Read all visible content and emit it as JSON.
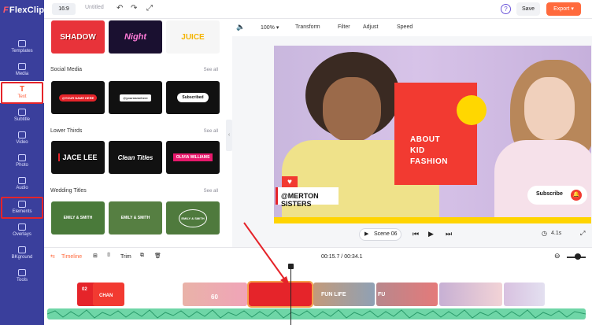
{
  "app": {
    "logo": "FlexClip"
  },
  "topbar": {
    "ratio": "16:9",
    "title": "Untitled",
    "help": "?",
    "save": "Save",
    "export": "Export ▾"
  },
  "sidebar": {
    "items": [
      {
        "label": "Templates",
        "icon": "templates-icon"
      },
      {
        "label": "Media",
        "icon": "media-icon"
      },
      {
        "label": "Text",
        "icon": "text-icon",
        "active": true
      },
      {
        "label": "Subtitle",
        "icon": "subtitle-icon"
      },
      {
        "label": "Video",
        "icon": "video-icon"
      },
      {
        "label": "Photo",
        "icon": "photo-icon"
      },
      {
        "label": "Audio",
        "icon": "audio-icon"
      },
      {
        "label": "Elements",
        "icon": "elements-icon"
      },
      {
        "label": "Overlays",
        "icon": "overlays-icon"
      },
      {
        "label": "BKground",
        "icon": "background-icon"
      },
      {
        "label": "Tools",
        "icon": "tools-icon"
      }
    ]
  },
  "panel": {
    "top_thumbs": [
      "SHADOW",
      "Night",
      "JUICE"
    ],
    "sections": [
      {
        "title": "Social Media",
        "see_all": "See all",
        "thumbs": [
          "@YOUR NAME HERE",
          "@yournamehere",
          "Subscribed"
        ]
      },
      {
        "title": "Lower Thirds",
        "see_all": "See all",
        "thumbs": [
          "JACE LEE",
          "Clean Titles",
          "OLIVIA WILLIAMS"
        ]
      },
      {
        "title": "Wedding Titles",
        "see_all": "See all",
        "thumbs": [
          "EMILY & SMITH",
          "EMILY & SMITH",
          "EMILY & SMITH"
        ]
      }
    ]
  },
  "preview_toolbar": {
    "volume": "🔈",
    "zoom": "100% ▾",
    "transform": "Transform",
    "filter": "Filter",
    "adjust": "Adjust",
    "speed": "Speed"
  },
  "video": {
    "card_lines": [
      "ABOUT",
      "KID",
      "FASHION"
    ],
    "name_tag": "@MERTON SISTERS",
    "subscribe": "Subscribe"
  },
  "playback": {
    "scene": "Scene 06",
    "duration": "4.1s"
  },
  "timeline": {
    "label": "Timeline",
    "trim": "Trim",
    "time": "00:15.7 / 00:34.1",
    "clip_texts": [
      "02",
      "CHAN",
      "60",
      "FUN LIFE",
      "FU"
    ]
  },
  "colors": {
    "accent": "#ff6a3d",
    "sidebar": "#3a3f9c",
    "highlight": "#e5242a"
  }
}
